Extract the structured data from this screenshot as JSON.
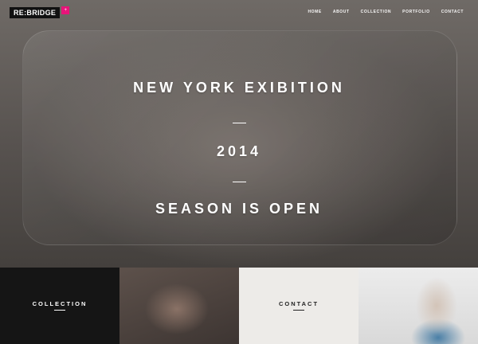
{
  "brand": {
    "logo_text": "RE:BRIDGE",
    "badge": "+"
  },
  "nav": {
    "items": [
      "HOME",
      "ABOUT",
      "COLLECTION",
      "PORTFOLIO",
      "CONTACT"
    ]
  },
  "hero": {
    "line1": "NEW YORK EXIBITION",
    "line2": "2014",
    "line3": "SEASON IS OPEN"
  },
  "tiles": {
    "collection_label": "COLLECTION",
    "contact_label": "CONTACT"
  },
  "colors": {
    "accent": "#e8147a",
    "dark": "#151515",
    "light": "#edebe8",
    "text_light": "#ffffff",
    "text_dark": "#222222"
  }
}
